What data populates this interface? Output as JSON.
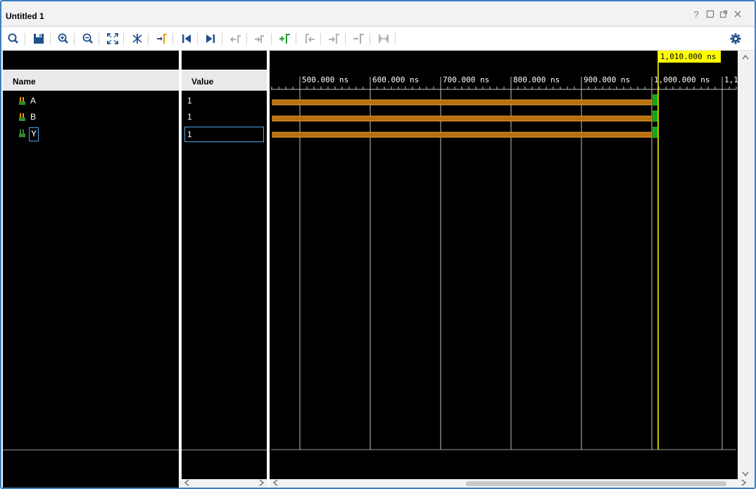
{
  "window": {
    "title": "Untitled 1",
    "controls": [
      "help",
      "restore",
      "float",
      "close"
    ]
  },
  "toolbar": {
    "buttons": [
      "search",
      "save",
      "zoom-in",
      "zoom-out",
      "zoom-fit",
      "swap-cursor",
      "snap-to-transition",
      "go-to-start",
      "go-to-end",
      "previous-transition",
      "next-transition",
      "add-marker",
      "previous-marker",
      "next-marker",
      "delete-marker",
      "marker-span",
      "settings"
    ]
  },
  "names_panel": {
    "header": "Name"
  },
  "values_panel": {
    "header": "Value"
  },
  "signals": [
    {
      "name": "A",
      "value": "1",
      "selected": false
    },
    {
      "name": "B",
      "value": "1",
      "selected": false
    },
    {
      "name": "Y",
      "value": "1",
      "selected": true
    }
  ],
  "waveform": {
    "cursor_label": "1,010.000 ns",
    "ticks": [
      "500.000 ns",
      "600.000 ns",
      "700.000 ns",
      "800.000 ns",
      "900.000 ns",
      "1,000.000 ns",
      "1,1"
    ],
    "colors": {
      "bus": "#c47a12",
      "bus_edge": "#f0a030",
      "transition": "#13a813",
      "cursor": "#ffff00",
      "gridline": "#bfbfbf"
    }
  }
}
